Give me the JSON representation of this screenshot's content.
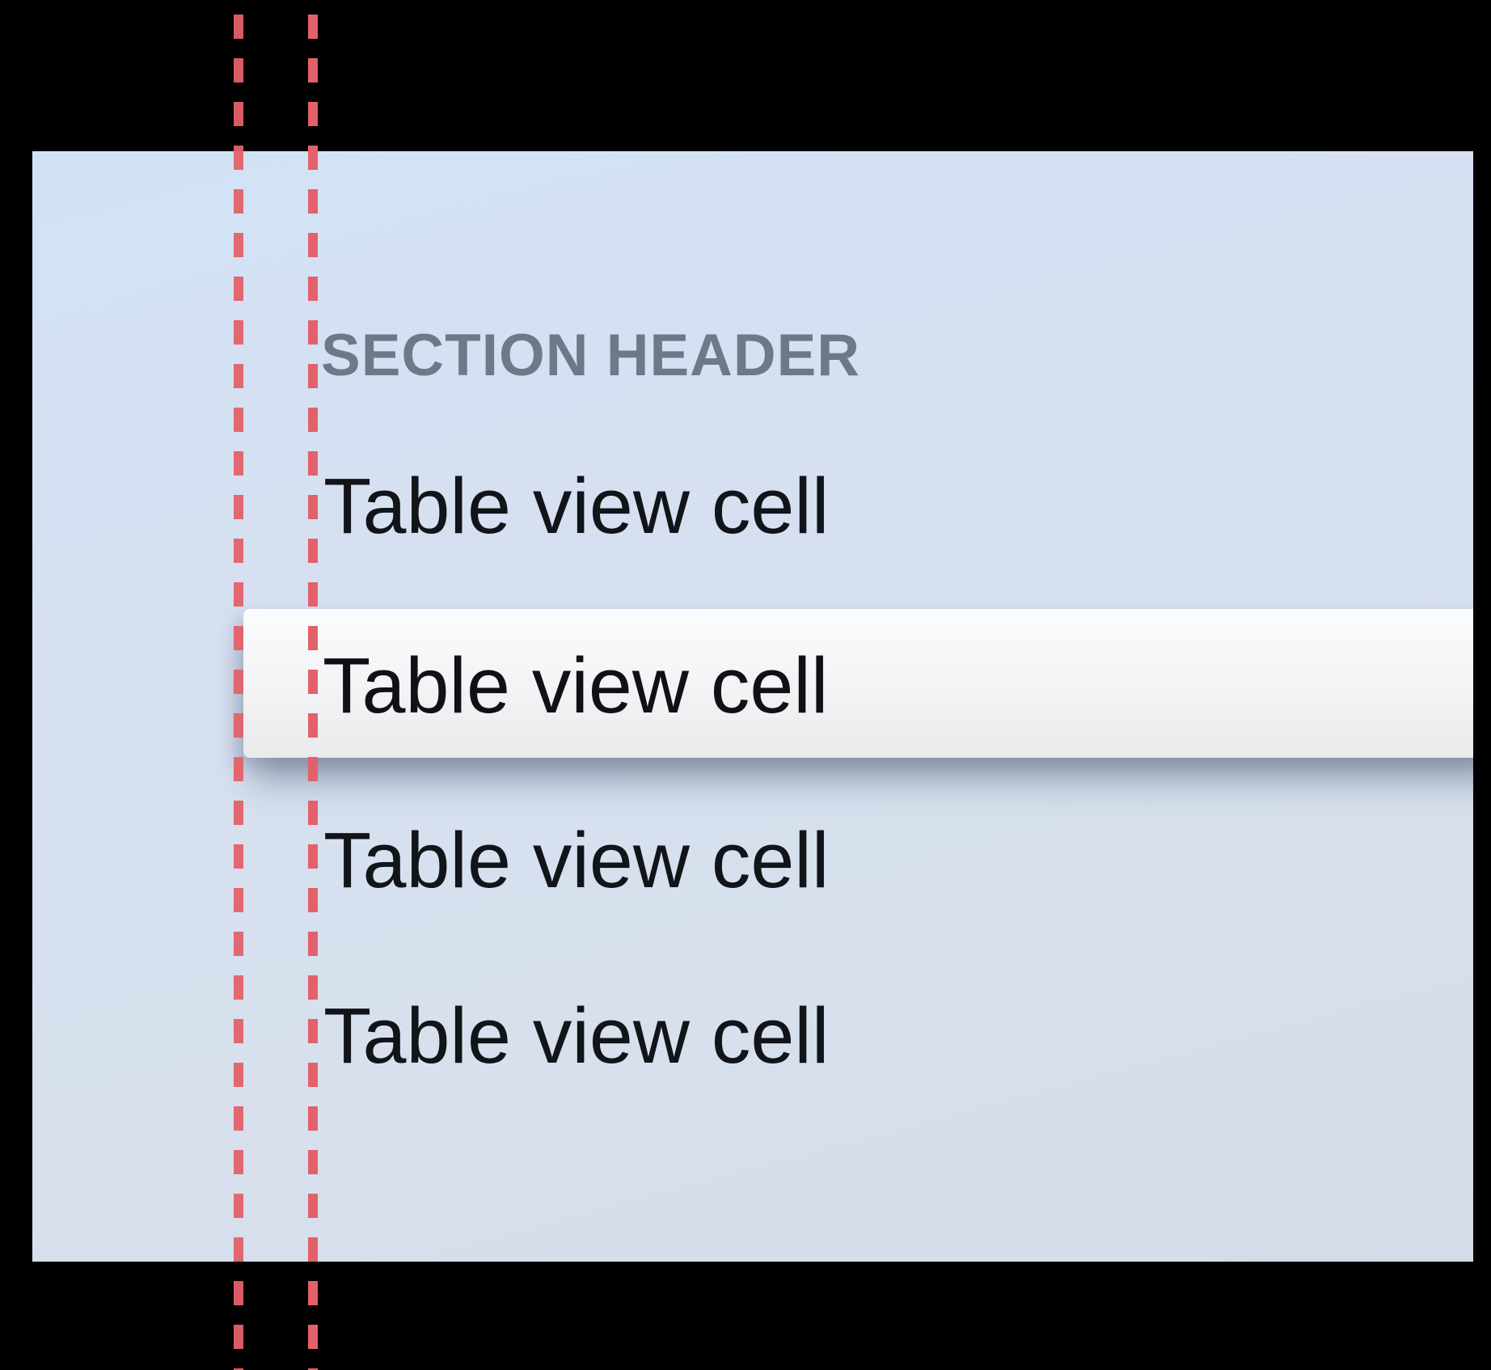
{
  "table": {
    "section_header": "SECTION HEADER",
    "cells": [
      {
        "label": "Table view cell",
        "focused": false
      },
      {
        "label": "Table view cell",
        "focused": true
      },
      {
        "label": "Table view cell",
        "focused": false
      },
      {
        "label": "Table view cell",
        "focused": false
      }
    ]
  },
  "colors": {
    "background": "#000000",
    "screen_gradient_top": "#d2e2f6",
    "screen_gradient_bottom": "#d3dce8",
    "header_text": "#6c7988",
    "cell_text": "#111418",
    "focused_cell_background": "#f1f3f5",
    "guide_line": "#e2616a"
  }
}
